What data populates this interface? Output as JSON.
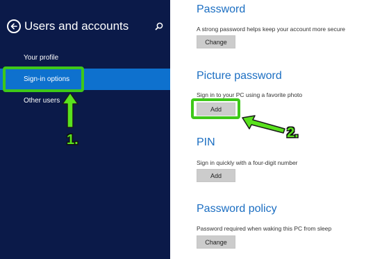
{
  "sidebar": {
    "title": "Users and accounts",
    "items": [
      {
        "label": "Your profile"
      },
      {
        "label": "Sign-in options"
      },
      {
        "label": "Other users"
      }
    ]
  },
  "sections": {
    "password": {
      "title": "Password",
      "desc": "A strong password helps keep your account more secure",
      "button": "Change"
    },
    "picture_password": {
      "title": "Picture password",
      "desc": "Sign in to your PC using a favorite photo",
      "button": "Add"
    },
    "pin": {
      "title": "PIN",
      "desc": "Sign in quickly with a four-digit number",
      "button": "Add"
    },
    "policy": {
      "title": "Password policy",
      "desc": "Password required when waking this PC from sleep",
      "button": "Change"
    }
  },
  "annotations": {
    "step1": "1.",
    "step2": "2."
  },
  "colors": {
    "sidebar_bg": "#0b1a49",
    "selected": "#0e71ce",
    "accent_text": "#1b6ec2",
    "highlight": "#3ec819"
  },
  "icons": {
    "back": "back-arrow-icon",
    "search": "search-icon"
  }
}
